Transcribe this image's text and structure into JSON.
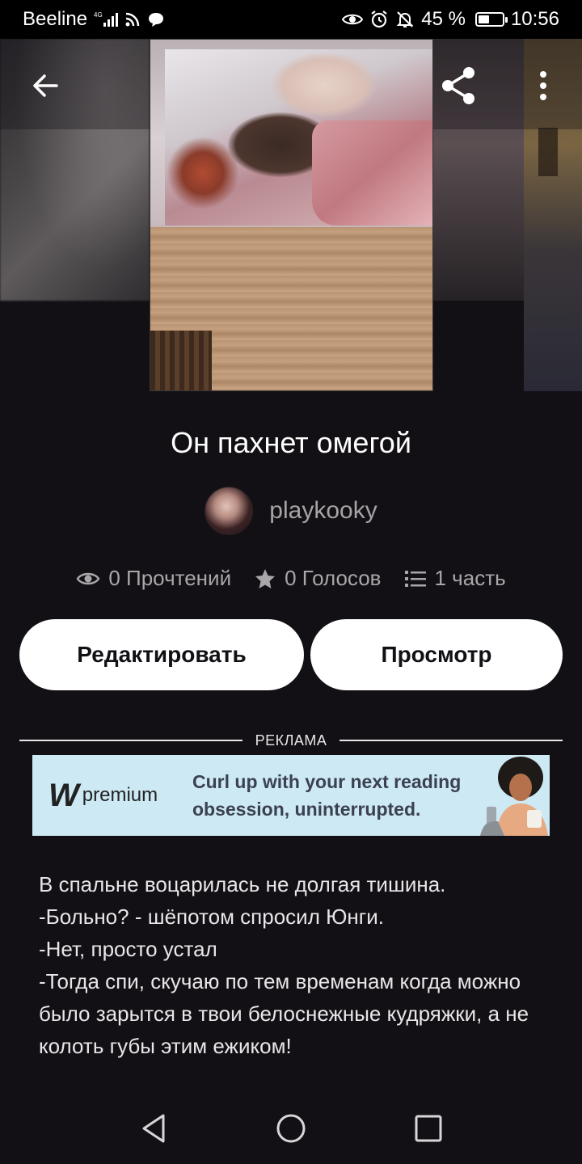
{
  "status_bar": {
    "carrier": "Beeline",
    "network": "4G",
    "battery": "45 %",
    "battery_fraction": 0.45,
    "time": "10:56"
  },
  "icons": {
    "back": "arrow-left-icon",
    "share": "share-icon",
    "more": "more-vertical-icon",
    "reads": "eye-icon",
    "votes": "star-icon",
    "parts": "list-icon",
    "nav_back": "triangle-back-icon",
    "nav_home": "circle-home-icon",
    "nav_recent": "square-recent-icon"
  },
  "story": {
    "title": "Он пахнет омегой",
    "author": "playkooky",
    "stats": {
      "reads": "0 Прочтений",
      "votes": "0 Голосов",
      "parts": "1 часть"
    }
  },
  "actions": {
    "edit_label": "Редактировать",
    "preview_label": "Просмотр"
  },
  "ad": {
    "label": "РЕКЛАМА",
    "logo_mark": "W",
    "logo_text": "premium",
    "line1": "Curl up with your next reading",
    "line2": "obsession, uninterrupted."
  },
  "excerpt": {
    "lines": [
      "В спальне воцарилась не долгая тишина.",
      "-Больно? - шёпотом спросил Юнги.",
      "-Нет, просто устал",
      "-Тогда спи, скучаю по тем временам когда можно было зарытся в твои белоснежные кудряжки, а не колоть губы этим ежиком!"
    ]
  },
  "colors": {
    "background": "#121014",
    "button_bg": "#ffffff",
    "ad_bg": "#cde9f4",
    "muted_text": "#aaa6aa"
  }
}
